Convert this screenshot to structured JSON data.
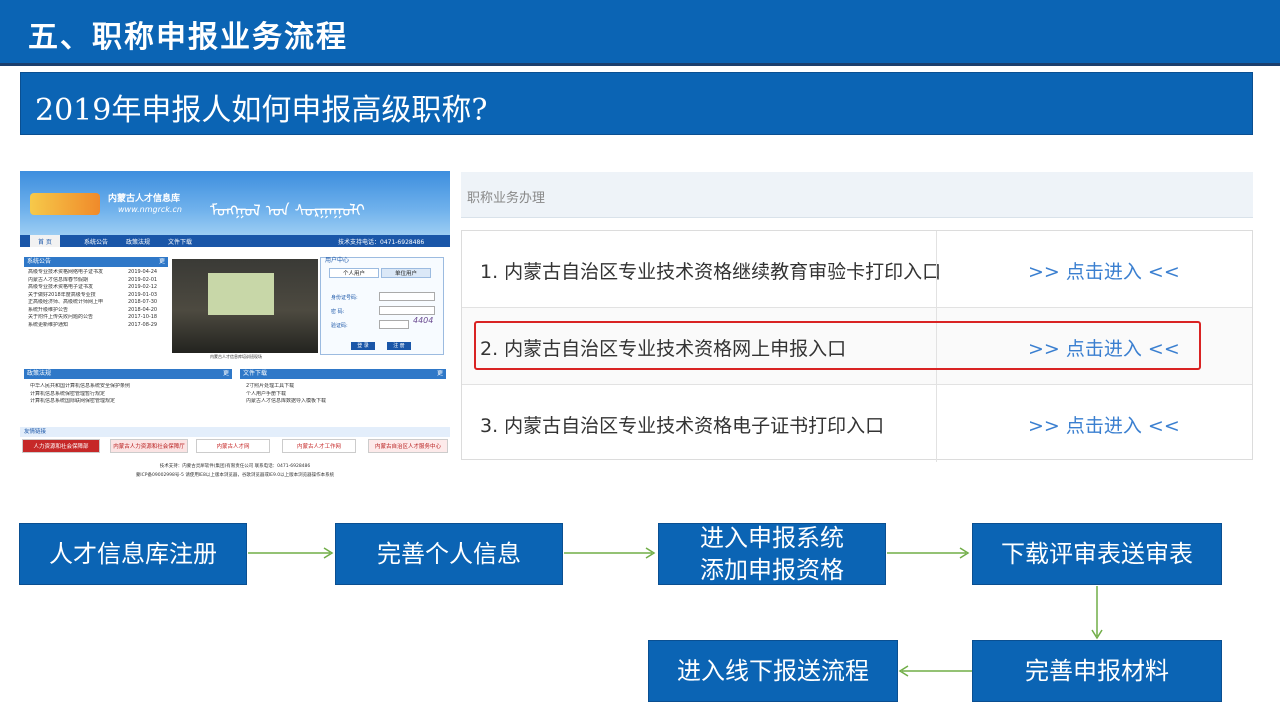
{
  "header": {
    "title": "五、职称申报业务流程"
  },
  "subtitle": {
    "text": "2019年申报人如何申报高级职称?"
  },
  "site": {
    "logo_text": "内蒙古人才信息库",
    "logo_url": "www.nmgrck.cn",
    "mongolian": "ᠮᠣᠩᠭᠣᠯ ᠤᠨ ᠰᠤᠷᠭᠠᠭᠤᠯᠢ",
    "nav": {
      "home": "首  页",
      "announce": "系统公告",
      "policy": "政策法规",
      "downloads": "文件下载",
      "support": "技术支持电话：0471-6928486"
    },
    "announcements": {
      "title": "系统公告",
      "more": "更",
      "items": [
        {
          "text": "高级专业技术资格网络电子证书发",
          "date": "2019-04-24"
        },
        {
          "text": "内蒙古人才信息库春节假期",
          "date": "2019-02-01"
        },
        {
          "text": "高级专业技术资格电子证书发",
          "date": "2019-02-12"
        },
        {
          "text": "关于做好2018年度高级专业技",
          "date": "2019-01-03"
        },
        {
          "text": "正高级经济师、高级统计师网上申",
          "date": "2018-07-30"
        },
        {
          "text": "系统升级维护公告",
          "date": "2018-04-20"
        },
        {
          "text": "关于附件上传失败问题的公告",
          "date": "2017-10-18"
        },
        {
          "text": "系统更新维护通知",
          "date": "2017-08-29"
        }
      ]
    },
    "photo_caption": "内蒙古人才信息库培训班现场",
    "login": {
      "user_center": "用户中心",
      "tab_personal": "个人用户",
      "tab_unit": "单位用户",
      "id_label": "身份证号码:",
      "password_label": "密  码:",
      "captcha_label": "验证码:",
      "captcha_value": "4404",
      "login_button": "登 录",
      "register_button": "注 册"
    },
    "regulations": {
      "title": "政策法规",
      "more": "更",
      "items": [
        "中华人民共和国计算机信息系统安全保护条例",
        "计算机信息系统保密管理暂行规定",
        "计算机信息系统国际联网保密管理规定"
      ]
    },
    "downloads": {
      "title": "文件下载",
      "more": "更",
      "items": [
        "2寸照片处理工具下载",
        "个人用户手册下载",
        "内蒙古人才信息库数据导入模板下载"
      ]
    },
    "links": {
      "title": "友情链接",
      "items": [
        "人力资源和社会保障部",
        "内蒙古人力资源和社会保障厅",
        "内蒙古人才网",
        "内蒙古人才工作网",
        "内蒙古自治区人才服务中心"
      ]
    },
    "footer": {
      "line1": "技术支持：内蒙古灵犀软件(集团)有限责任公司  联系电话：0471-6928486",
      "line2": "蒙ICP备09002998号-5   请使用IE8以上版本浏览器，谷歌浏览器或IE9.0以上版本浏览器操作本系统"
    }
  },
  "business": {
    "header": "职称业务办理",
    "rows": [
      {
        "name": "1. 内蒙古自治区专业技术资格继续教育审验卡打印入口",
        "enter": ">> 点击进入 <<"
      },
      {
        "name": "2. 内蒙古自治区专业技术资格网上申报入口",
        "enter": ">> 点击进入 <<"
      },
      {
        "name": "3. 内蒙古自治区专业技术资格电子证书打印入口",
        "enter": ">> 点击进入 <<"
      }
    ]
  },
  "flow": {
    "steps": [
      "人才信息库注册",
      "完善个人信息",
      "进入申报系统\n添加申报资格",
      "下载评审表送审表",
      "完善申报材料",
      "进入线下报送流程"
    ],
    "arrow_color": "#70ad47"
  }
}
